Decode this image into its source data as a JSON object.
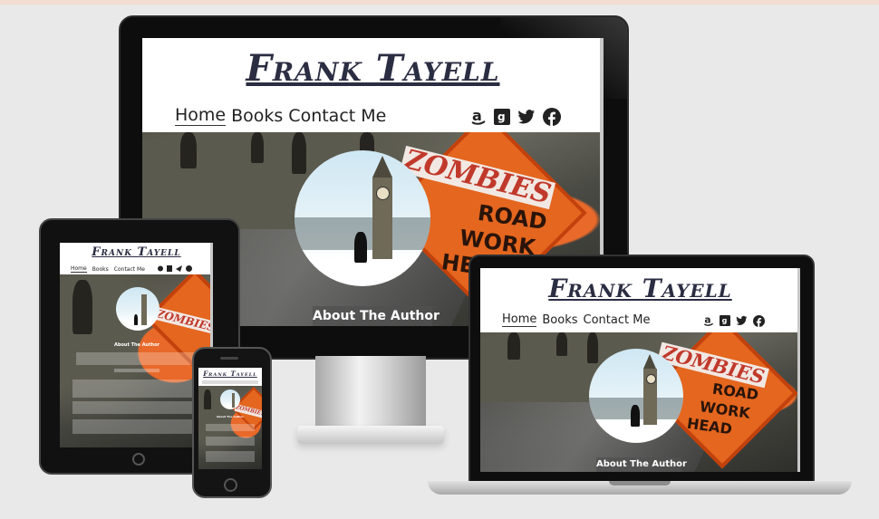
{
  "site": {
    "brand": "Frank Tayell",
    "nav": [
      "Home",
      "Books",
      "Contact Me"
    ],
    "hero_heading": "About The Author",
    "sign_word": "ZOMBIES",
    "sign_lines": [
      "ROAD",
      "WORK",
      "HEAD"
    ],
    "social_icons": [
      "amazon-icon",
      "goodreads-icon",
      "twitter-icon",
      "facebook-icon"
    ]
  },
  "colors": {
    "brand_text": "#2b2d42",
    "sign_orange": "#e4661f",
    "background": "#e9e9e9"
  }
}
